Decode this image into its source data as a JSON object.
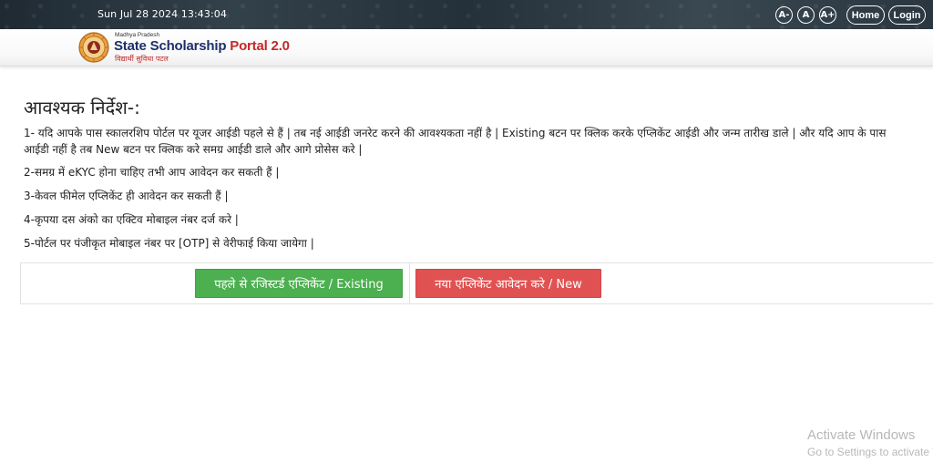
{
  "topbar": {
    "datetime": "Sun Jul 28 2024 13:43:04",
    "font_decrease": "A-",
    "font_normal": "A",
    "font_increase": "A+",
    "home": "Home",
    "login": "Login"
  },
  "logo": {
    "state": "Madhya Pradesh",
    "title_part1": "State Scholarship ",
    "title_part2": "Portal 2.0",
    "subtitle": "विद्यार्थी सुविधा पटल"
  },
  "instructions": {
    "heading": "आवश्यक निर्देश-:",
    "items": [
      "1- यदि आपके पास स्कालरशिप पोर्टल पर यूजर आईडी पहले से हैं | तब नई आईडी जनरेट करने की आवश्यकता नहीं है | Existing बटन पर क्लिक करके एप्लिकेंट आईडी और जन्म तारीख डाले | और यदि आप के पास",
      "आईडी नहीं है तब New बटन पर क्लिक करे समग्र आईडी डाले और आगे प्रोसेस करे |",
      "2-समग्र में eKYC होना चाहिए तभी आप आवेदन कर सकती हैं |",
      "3-केवल फीमेल एप्लिकेंट ही आवेदन कर सकती हैं |",
      "4-कृपया दस अंको का एक्टिव मोबाइल नंबर दर्ज करे |",
      "5-पोर्टल पर पंजीकृत मोबाइल नंबर पर [OTP] से वेरीफाई किया जायेगा |"
    ]
  },
  "buttons": {
    "existing": "पहले से रजिस्टर्ड एप्लिकेंट / Existing",
    "new": "नया एप्लिकेंट आवेदन करे / New"
  },
  "watermark": {
    "line1": "Activate Windows",
    "line2": "Go to Settings to activate Windows."
  },
  "colors": {
    "green_button": "#4caf50",
    "red_button": "#e05252",
    "logo_blue": "#1d2f6b",
    "logo_red": "#c62828"
  }
}
